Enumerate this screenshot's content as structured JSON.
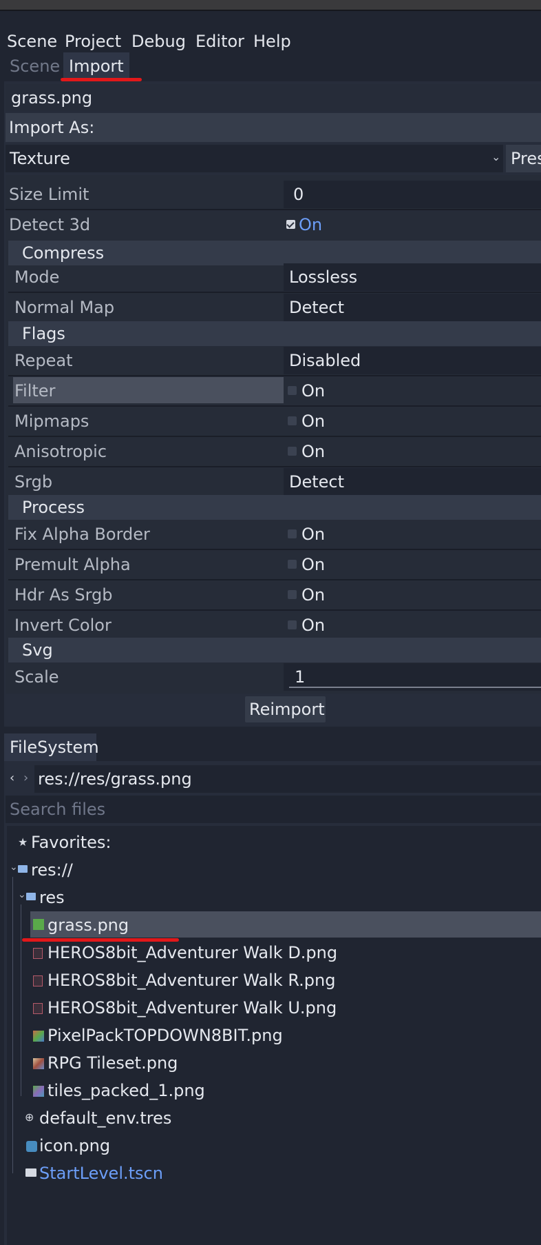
{
  "menu": [
    "Scene",
    "Project",
    "Debug",
    "Editor",
    "Help"
  ],
  "tabs": {
    "scene": "Scene",
    "import": "Import"
  },
  "import": {
    "file": "grass.png",
    "import_as_label": "Import As:",
    "import_as_value": "Texture",
    "preset_label": "Pres",
    "reimport_label": "Reimport",
    "size_limit": {
      "label": "Size Limit",
      "value": "0"
    },
    "detect_3d": {
      "label": "Detect 3d",
      "value": "On"
    },
    "compress": {
      "header": "Compress",
      "mode": {
        "label": "Mode",
        "value": "Lossless"
      },
      "normal_map": {
        "label": "Normal Map",
        "value": "Detect"
      }
    },
    "flags": {
      "header": "Flags",
      "repeat": {
        "label": "Repeat",
        "value": "Disabled"
      },
      "filter": {
        "label": "Filter",
        "value": "On"
      },
      "mipmaps": {
        "label": "Mipmaps",
        "value": "On"
      },
      "anisotropic": {
        "label": "Anisotropic",
        "value": "On"
      },
      "srgb": {
        "label": "Srgb",
        "value": "Detect"
      }
    },
    "process": {
      "header": "Process",
      "fix_alpha": {
        "label": "Fix Alpha Border",
        "value": "On"
      },
      "premult": {
        "label": "Premult Alpha",
        "value": "On"
      },
      "hdr": {
        "label": "Hdr As Srgb",
        "value": "On"
      },
      "invert": {
        "label": "Invert Color",
        "value": "On"
      }
    },
    "svg": {
      "header": "Svg",
      "scale": {
        "label": "Scale",
        "value": "1"
      }
    }
  },
  "filesystem": {
    "tab": "FileSystem",
    "path": "res://res/grass.png",
    "search_placeholder": "Search files",
    "favorites": "Favorites:",
    "root": "res://",
    "folder": "res",
    "files": [
      "grass.png",
      "HEROS8bit_Adventurer Walk D.png",
      "HEROS8bit_Adventurer Walk R.png",
      "HEROS8bit_Adventurer Walk U.png",
      "PixelPackTOPDOWN8BIT.png",
      "RPG Tileset.png",
      "tiles_packed_1.png"
    ],
    "root_files": [
      "default_env.tres",
      "icon.png",
      "StartLevel.tscn"
    ]
  },
  "colors": {
    "accent": "#6c9ef8",
    "highlight_red": "#e2181a"
  }
}
